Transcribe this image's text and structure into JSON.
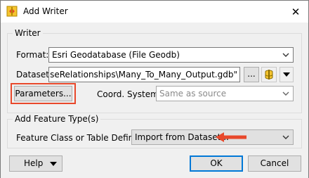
{
  "window": {
    "title": "Add Writer",
    "close_glyph": "✕",
    "app_icon": "fme-writer-icon"
  },
  "writer_group": {
    "label": "Writer",
    "format_label": "Format:",
    "format_value": "Esri Geodatabase (File Geodb)",
    "dataset_label": "Dataset:",
    "dataset_value": "eodatabaseRelationships\\Many_To_Many_Output.gdb\"",
    "browse_label": "...",
    "parameters_label": "Parameters...",
    "coord_label": "Coord. System:",
    "coord_placeholder": "Same as source"
  },
  "feature_group": {
    "label": "Add Feature Type(s)",
    "definition_label": "Feature Class or Table Definition:",
    "definition_value": "Import from Dataset..."
  },
  "footer": {
    "help_label": "Help",
    "ok_label": "OK",
    "cancel_label": "Cancel"
  },
  "colors": {
    "highlight": "#e8482b",
    "arrow": "#e8482b",
    "default_button_border": "#0078d7"
  }
}
